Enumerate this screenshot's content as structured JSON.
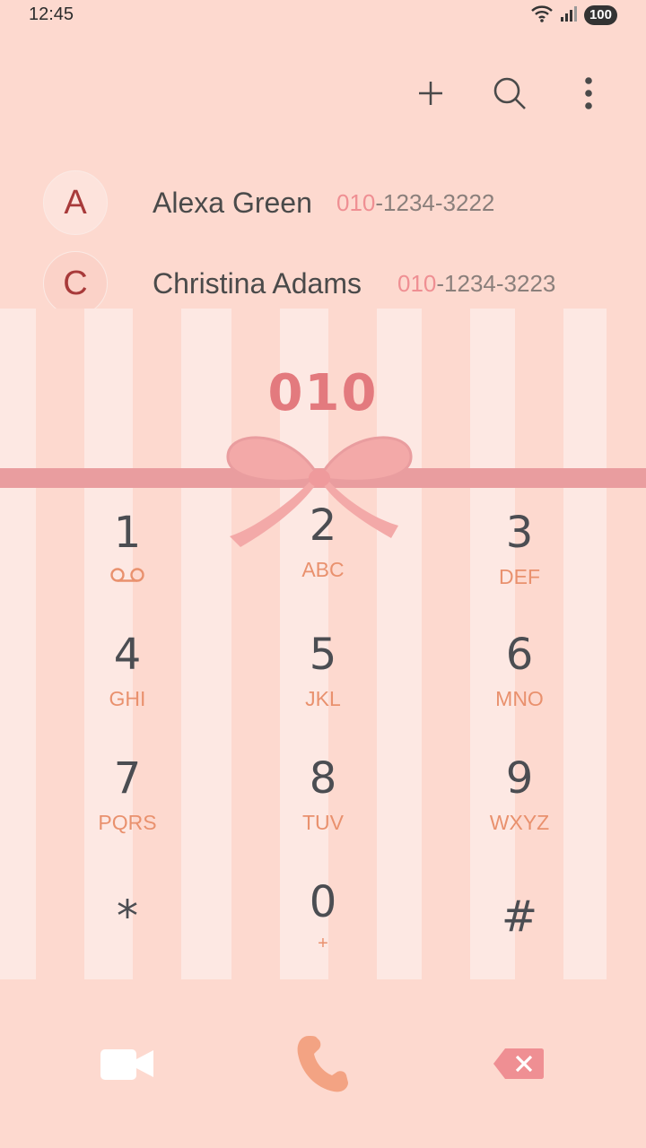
{
  "status_bar": {
    "time": "12:45",
    "battery": "100"
  },
  "toolbar": {
    "add_icon": "plus-icon",
    "search_icon": "search-icon",
    "more_icon": "more-vertical-icon"
  },
  "contacts": [
    {
      "initial": "A",
      "name": "Alexa Green",
      "phone_match": "010",
      "phone_rest": "-1234-3222"
    },
    {
      "initial": "C",
      "name": "Christina Adams",
      "phone_match": "010",
      "phone_rest": "-1234-3223"
    }
  ],
  "dialer": {
    "entered": "010",
    "keys": [
      {
        "num": "1",
        "letters": ""
      },
      {
        "num": "2",
        "letters": "ABC"
      },
      {
        "num": "3",
        "letters": "DEF"
      },
      {
        "num": "4",
        "letters": "GHI"
      },
      {
        "num": "5",
        "letters": "JKL"
      },
      {
        "num": "6",
        "letters": "MNO"
      },
      {
        "num": "7",
        "letters": "PQRS"
      },
      {
        "num": "8",
        "letters": "TUV"
      },
      {
        "num": "9",
        "letters": "WXYZ"
      },
      {
        "num": "*",
        "letters": ""
      },
      {
        "num": "0",
        "letters": "+"
      },
      {
        "num": "#",
        "letters": ""
      }
    ]
  },
  "actions": {
    "video_icon": "video-call-icon",
    "call_icon": "phone-call-icon",
    "delete_icon": "backspace-icon"
  },
  "colors": {
    "background": "#fdd9cf",
    "accent": "#e37a7e",
    "call": "#f3a383"
  }
}
